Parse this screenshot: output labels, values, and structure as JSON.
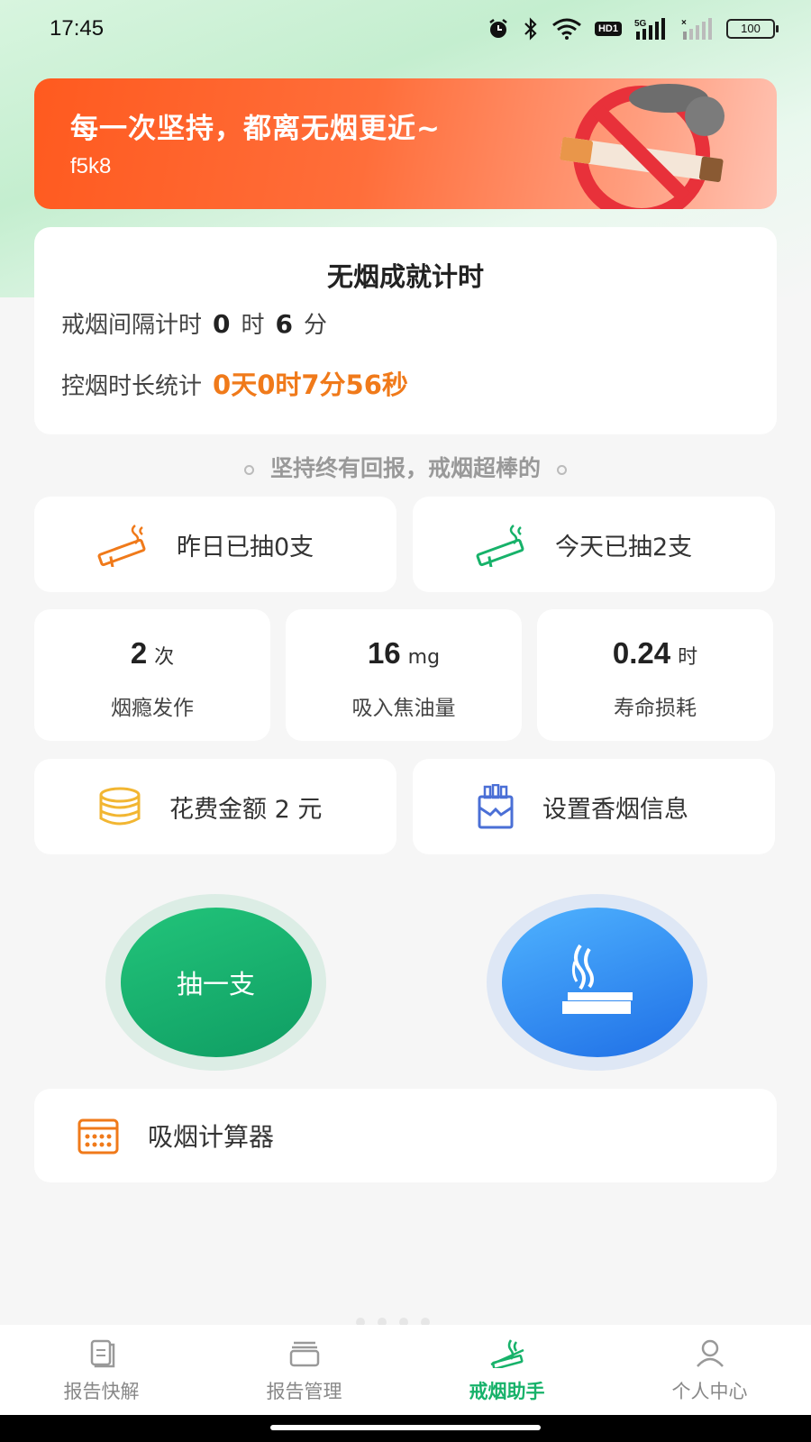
{
  "status_bar": {
    "time": "17:45",
    "battery": "100",
    "hd_label": "HD1",
    "network_label": "5G",
    "icons": [
      "alarm-icon",
      "bluetooth-icon",
      "wifi-icon",
      "hd-icon",
      "signal-5g-icon",
      "signal-icon",
      "battery-icon"
    ]
  },
  "banner": {
    "title": "每一次坚持，都离无烟更近~",
    "subtitle": "f5k8"
  },
  "timer": {
    "title": "无烟成就计时",
    "interval_label": "戒烟间隔计时",
    "interval_hours": "0",
    "hours_unit": "时",
    "interval_minutes": "6",
    "minutes_unit": "分",
    "duration_label": "控烟时长统计",
    "duration_value": "0天0时7分56秒"
  },
  "motto": "坚持终有回报，戒烟超棒的",
  "smoked": {
    "yesterday": "昨日已抽0支",
    "today": "今天已抽2支"
  },
  "stats": [
    {
      "value": "2",
      "unit": "次",
      "caption": "烟瘾发作"
    },
    {
      "value": "16",
      "unit": "mg",
      "caption": "吸入焦油量"
    },
    {
      "value": "0.24",
      "unit": "时",
      "caption": "寿命损耗"
    }
  ],
  "cost": {
    "label": "花费金额 2 元"
  },
  "cigarette_settings": {
    "label": "设置香烟信息"
  },
  "actions": {
    "smoke_one": "抽一支"
  },
  "calculator": {
    "label": "吸烟计算器"
  },
  "tabs": [
    {
      "label": "报告快解",
      "icon": "report-icon"
    },
    {
      "label": "报告管理",
      "icon": "archive-icon"
    },
    {
      "label": "戒烟助手",
      "icon": "smoking-icon"
    },
    {
      "label": "个人中心",
      "icon": "user-icon"
    }
  ],
  "colors": {
    "accent_green": "#17b26a",
    "accent_orange": "#f07a1a",
    "banner_orange": "#ff5a1f",
    "blue": "#1f6fe6"
  }
}
